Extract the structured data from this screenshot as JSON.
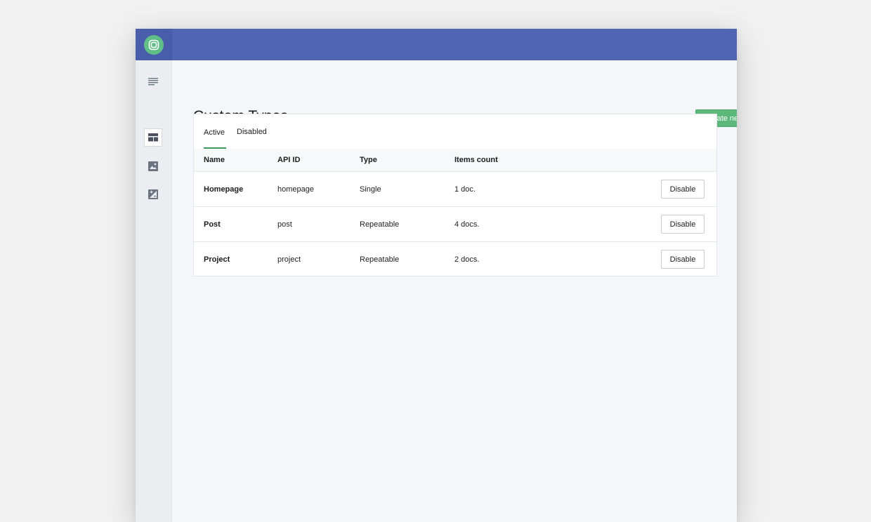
{
  "brand": {
    "logo_icon": "prismic-logo-icon",
    "topbar_color": "#5265b5",
    "accent_color": "#5cb77b"
  },
  "sidebar": {
    "items": [
      {
        "name": "documents",
        "icon": "list-lines-icon",
        "active": false
      },
      {
        "name": "custom-types",
        "icon": "table-layout-icon",
        "active": true
      },
      {
        "name": "media",
        "icon": "image-icon",
        "active": false
      },
      {
        "name": "slices",
        "icon": "image-edit-icon",
        "active": false
      }
    ]
  },
  "header": {
    "title": "Custom Types",
    "create_label": "Create new"
  },
  "tabs": [
    {
      "label": "Active",
      "selected": true
    },
    {
      "label": "Disabled",
      "selected": false
    }
  ],
  "table": {
    "columns": [
      "Name",
      "API ID",
      "Type",
      "Items count"
    ],
    "rows": [
      {
        "name": "Homepage",
        "api_id": "homepage",
        "type": "Single",
        "count": "1 doc.",
        "action": "Disable"
      },
      {
        "name": "Post",
        "api_id": "post",
        "type": "Repeatable",
        "count": "4 docs.",
        "action": "Disable"
      },
      {
        "name": "Project",
        "api_id": "project",
        "type": "Repeatable",
        "count": "2 docs.",
        "action": "Disable"
      }
    ]
  }
}
